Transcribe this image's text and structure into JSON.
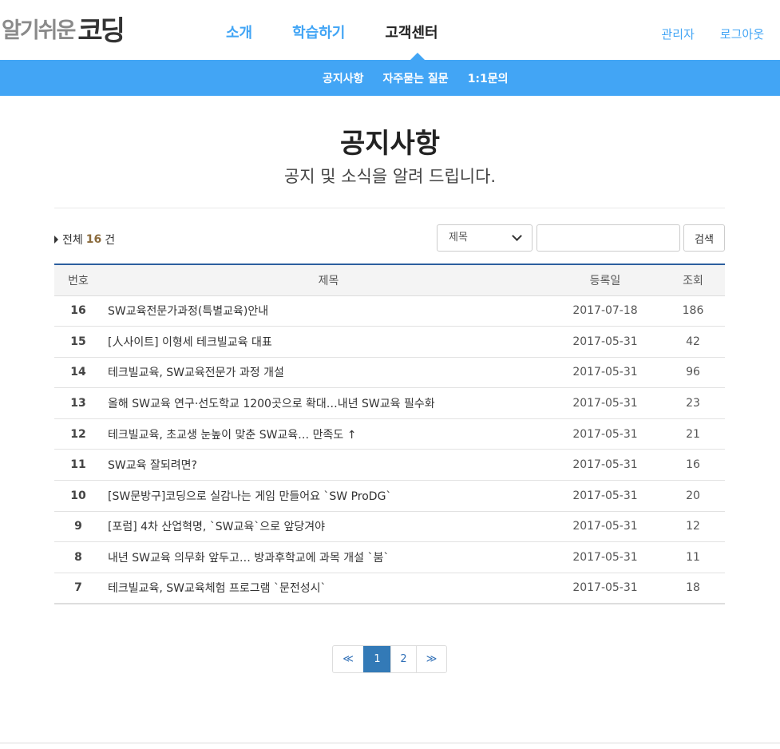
{
  "logo": {
    "small": "알기쉬운",
    "big": "코딩"
  },
  "main_nav": [
    "소개",
    "학습하기",
    "고객센터"
  ],
  "user_nav": [
    "관리자",
    "로그아웃"
  ],
  "sub_nav": [
    "공지사항",
    "자주묻는 질문",
    "1:1문의"
  ],
  "page": {
    "title": "공지사항",
    "subtitle": "공지 및 소식을 알려 드립니다."
  },
  "summary": {
    "prefix": "전체",
    "count": "16",
    "suffix": "건"
  },
  "search": {
    "select_value": "제목",
    "input_value": "",
    "button": "검색"
  },
  "table": {
    "headers": [
      "번호",
      "제목",
      "등록일",
      "조회"
    ],
    "rows": [
      {
        "num": "16",
        "title": "SW교육전문가과정(특별교육)안내",
        "date": "2017-07-18",
        "views": "186"
      },
      {
        "num": "15",
        "title": "[人사이트] 이형세 테크빌교육 대표",
        "date": "2017-05-31",
        "views": "42"
      },
      {
        "num": "14",
        "title": "테크빌교육, SW교육전문가 과정 개설",
        "date": "2017-05-31",
        "views": "96"
      },
      {
        "num": "13",
        "title": "올해 SW교육 연구·선도학교 1200곳으로 확대…내년 SW교육 필수화",
        "date": "2017-05-31",
        "views": "23"
      },
      {
        "num": "12",
        "title": "테크빌교육, 초교생 눈높이 맞춘 SW교육… 만족도 ↑",
        "date": "2017-05-31",
        "views": "21"
      },
      {
        "num": "11",
        "title": "SW교육 잘되려면?",
        "date": "2017-05-31",
        "views": "16"
      },
      {
        "num": "10",
        "title": "[SW문방구]코딩으로 실감나는 게임 만들어요 `SW ProDG`",
        "date": "2017-05-31",
        "views": "20"
      },
      {
        "num": "9",
        "title": "[포럼] 4차 산업혁명, `SW교육`으로 앞당겨야",
        "date": "2017-05-31",
        "views": "12"
      },
      {
        "num": "8",
        "title": "내년 SW교육 의무화 앞두고… 방과후학교에 과목 개설 `붐`",
        "date": "2017-05-31",
        "views": "11"
      },
      {
        "num": "7",
        "title": "테크빌교육, SW교육체험 프로그램 `문전성시`",
        "date": "2017-05-31",
        "views": "18"
      }
    ]
  },
  "pagination": {
    "prev": "≪",
    "pages": [
      "1",
      "2"
    ],
    "next": "≫",
    "current": "1"
  },
  "colors": {
    "accent": "#42a5f5",
    "table_top_border": "#2c5f9e",
    "active_page": "#337ab7"
  }
}
